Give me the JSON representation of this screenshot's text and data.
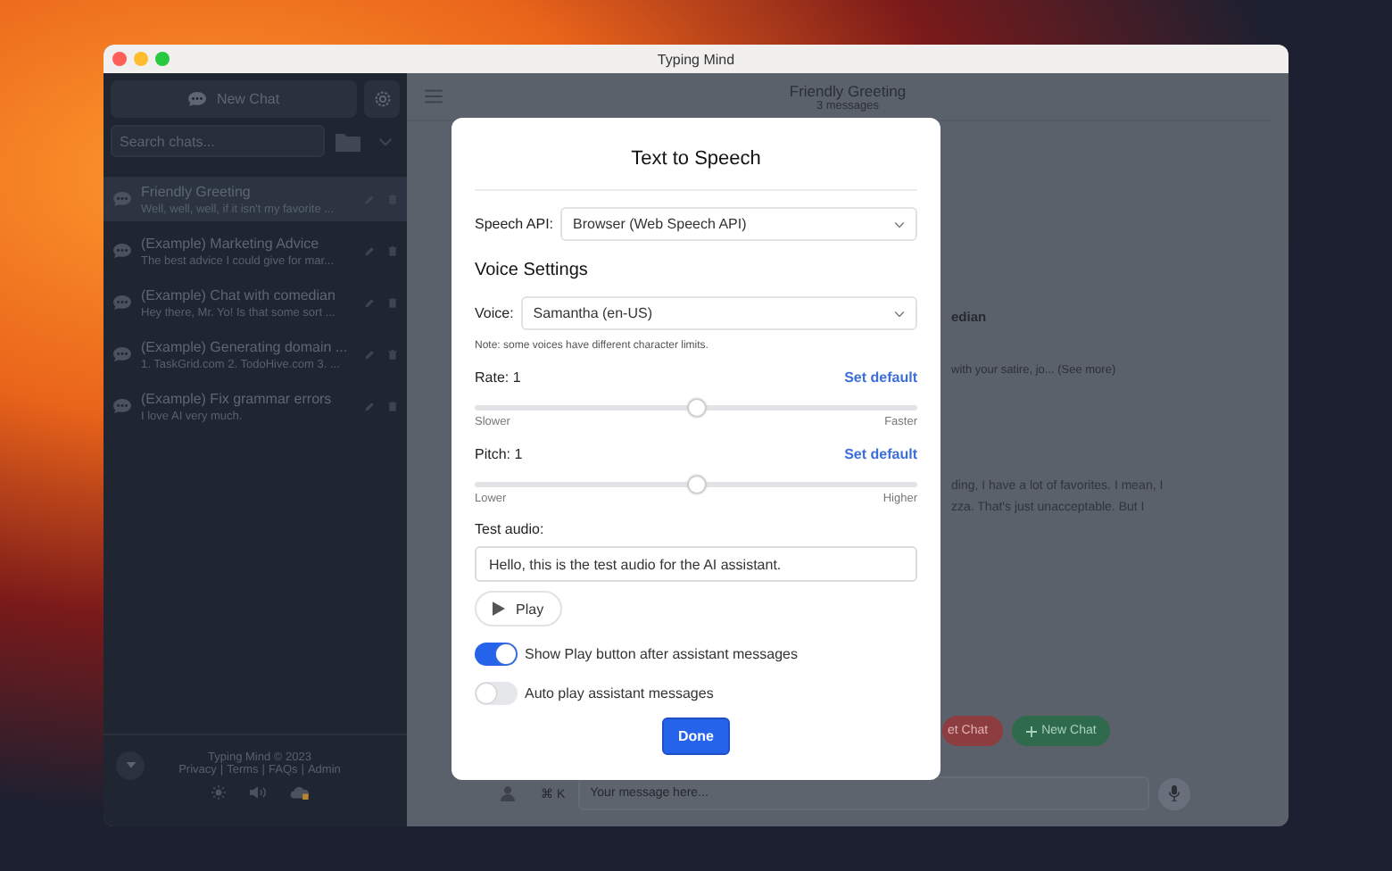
{
  "window": {
    "title": "Typing Mind"
  },
  "sidebar": {
    "new_chat": "New Chat",
    "search": {
      "placeholder": "Search chats..."
    },
    "chats": [
      {
        "title": "Friendly Greeting",
        "preview": "Well, well, well, if it isn't my favorite ...",
        "selected": true
      },
      {
        "title": "(Example) Marketing Advice",
        "preview": "The best advice I could give for mar...",
        "selected": false
      },
      {
        "title": "(Example) Chat with comedian",
        "preview": "Hey there, Mr. Yo! Is that some sort ...",
        "selected": false
      },
      {
        "title": "(Example) Generating domain ...",
        "preview": "1. TaskGrid.com 2. TodoHive.com 3. ...",
        "selected": false
      },
      {
        "title": "(Example) Fix grammar errors",
        "preview": "I love AI very much.",
        "selected": false
      }
    ],
    "footer": {
      "copyright": "Typing Mind © 2023",
      "links": [
        "Privacy",
        "Terms",
        "FAQs",
        "Admin"
      ],
      "separator": "|"
    }
  },
  "chat": {
    "title": "Friendly Greeting",
    "subtitle": "3 messages",
    "fragments": [
      {
        "kind": "heading",
        "text": "edian"
      },
      {
        "kind": "muted",
        "text": "with your satire, jo... (See more)"
      },
      {
        "kind": "body",
        "text": "ding, I have a lot of favorites. I mean, I"
      },
      {
        "kind": "body",
        "text": "zza. That's just unacceptable. But I"
      }
    ],
    "buttons": [
      {
        "kind": "danger",
        "label": "et Chat"
      },
      {
        "kind": "success",
        "label": "New Chat"
      }
    ],
    "input": {
      "shortcut": "⌘ K",
      "placeholder": "Your message here..."
    }
  },
  "dialog": {
    "title": "Text to Speech",
    "speech_api": {
      "label": "Speech API:",
      "value": "Browser (Web Speech API)"
    },
    "section": "Voice Settings",
    "voice": {
      "label": "Voice:",
      "value": "Samantha (en-US)"
    },
    "note": "Note: some voices have different character limits.",
    "sliders": [
      {
        "label": "Rate: 1",
        "action": "Set default",
        "level": 0.5,
        "min_label": "Slower",
        "max_label": "Faster"
      },
      {
        "label": "Pitch: 1",
        "action": "Set default",
        "level": 0.5,
        "min_label": "Lower",
        "max_label": "Higher"
      }
    ],
    "test_audio": {
      "label": "Test audio:",
      "value": "Hello, this is the test audio for the AI assistant."
    },
    "play": "Play",
    "toggles": [
      {
        "label": "Show Play button after assistant messages",
        "on": true
      },
      {
        "label": "Auto play assistant messages",
        "on": false
      }
    ],
    "done": "Done"
  }
}
